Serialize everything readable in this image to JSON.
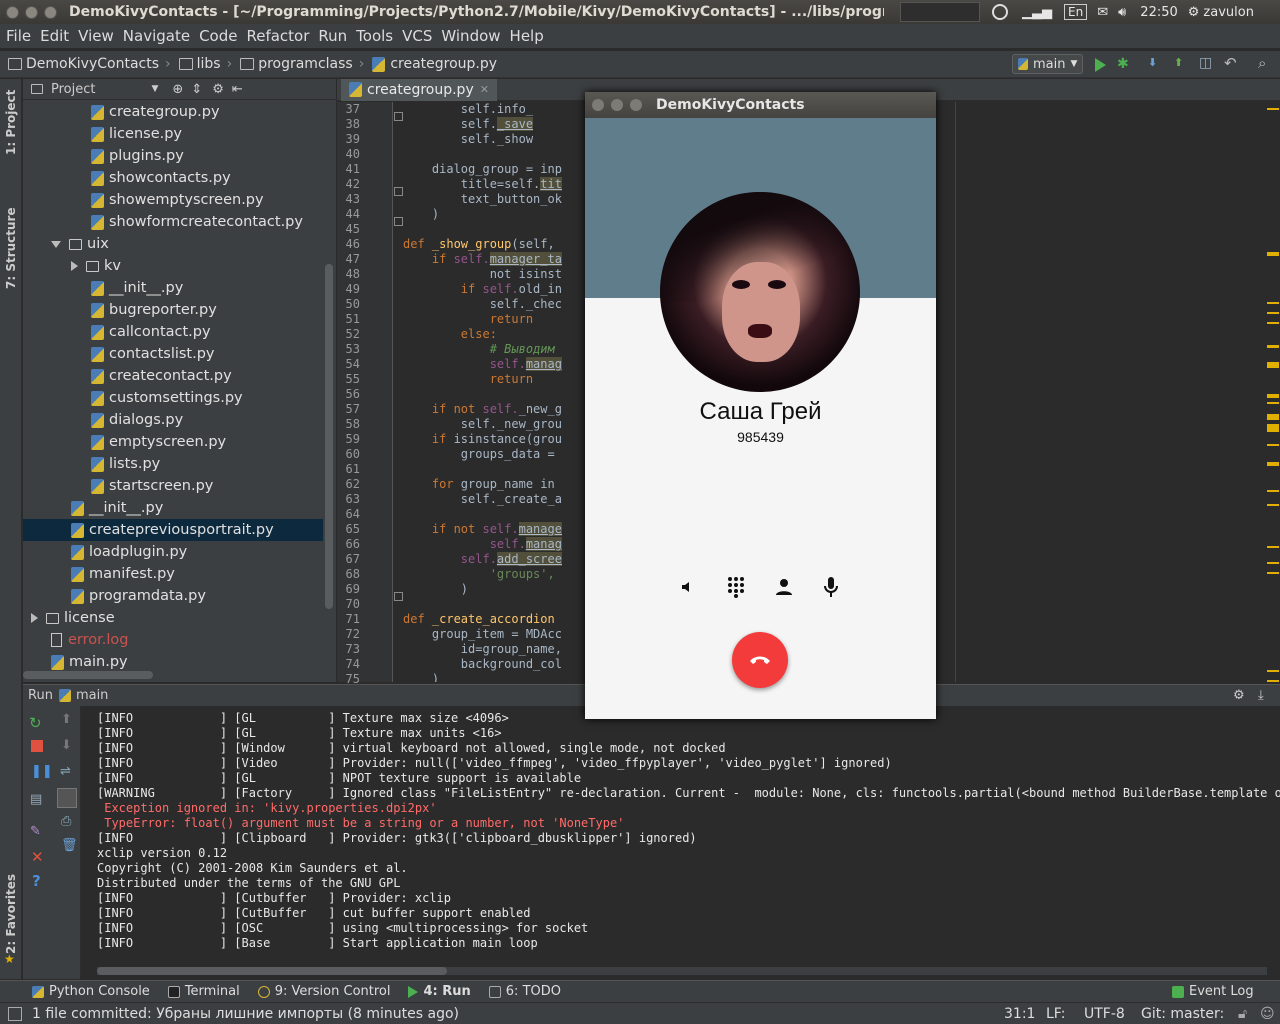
{
  "window": {
    "title": "DemoKivyContacts - [~/Programming/Projects/Python2.7/Mobile/Kivy/DemoKivyContacts] - .../libs/programclass/c",
    "tray": {
      "keyboard": "En",
      "time": "22:50",
      "user": "zavulon"
    }
  },
  "menu": [
    "File",
    "Edit",
    "View",
    "Navigate",
    "Code",
    "Refactor",
    "Run",
    "Tools",
    "VCS",
    "Window",
    "Help"
  ],
  "breadcrumb": [
    "DemoKivyContacts",
    "libs",
    "programclass",
    "creategroup.py"
  ],
  "run_config": "main",
  "left_strip": {
    "project": "1: Project",
    "structure": "7: Structure",
    "favorites": "2: Favorites"
  },
  "project_panel": {
    "title": "Project",
    "items": [
      {
        "label": "creategroup.py",
        "indent": 3,
        "type": "py"
      },
      {
        "label": "license.py",
        "indent": 3,
        "type": "py"
      },
      {
        "label": "plugins.py",
        "indent": 3,
        "type": "py"
      },
      {
        "label": "showcontacts.py",
        "indent": 3,
        "type": "py"
      },
      {
        "label": "showemptyscreen.py",
        "indent": 3,
        "type": "py"
      },
      {
        "label": "showformcreatecontact.py",
        "indent": 3,
        "type": "py"
      },
      {
        "label": "uix",
        "indent": 1,
        "type": "dir-open"
      },
      {
        "label": "kv",
        "indent": 2,
        "type": "dir-closed"
      },
      {
        "label": "__init__.py",
        "indent": 3,
        "type": "py"
      },
      {
        "label": "bugreporter.py",
        "indent": 3,
        "type": "py"
      },
      {
        "label": "callcontact.py",
        "indent": 3,
        "type": "py"
      },
      {
        "label": "contactslist.py",
        "indent": 3,
        "type": "py"
      },
      {
        "label": "createcontact.py",
        "indent": 3,
        "type": "py"
      },
      {
        "label": "customsettings.py",
        "indent": 3,
        "type": "py"
      },
      {
        "label": "dialogs.py",
        "indent": 3,
        "type": "py"
      },
      {
        "label": "emptyscreen.py",
        "indent": 3,
        "type": "py"
      },
      {
        "label": "lists.py",
        "indent": 3,
        "type": "py"
      },
      {
        "label": "startscreen.py",
        "indent": 3,
        "type": "py"
      },
      {
        "label": "__init__.py",
        "indent": 2,
        "type": "py"
      },
      {
        "label": "createpreviousportrait.py",
        "indent": 2,
        "type": "py",
        "selected": true
      },
      {
        "label": "loadplugin.py",
        "indent": 2,
        "type": "py"
      },
      {
        "label": "manifest.py",
        "indent": 2,
        "type": "py"
      },
      {
        "label": "programdata.py",
        "indent": 2,
        "type": "py"
      },
      {
        "label": "license",
        "indent": 0,
        "type": "dir-closed"
      },
      {
        "label": "error.log",
        "indent": 1,
        "type": "txt",
        "red": true
      },
      {
        "label": "main.py",
        "indent": 1,
        "type": "py"
      }
    ]
  },
  "editor": {
    "tab": "creategroup.py",
    "first_line": 37,
    "lines": [
      [
        [
          "        self.info_",
          "t"
        ]
      ],
      [
        [
          "        self.",
          "t"
        ],
        [
          "_save",
          "hl"
        ]
      ],
      [
        [
          "        self._show",
          "t"
        ]
      ],
      [
        [
          "",
          ""
        ]
      ],
      [
        [
          "    dialog_group = inp",
          "t"
        ]
      ],
      [
        [
          "        title=self.",
          "t"
        ],
        [
          "tit",
          "hl"
        ]
      ],
      [
        [
          "        text_button_ok",
          "t"
        ]
      ],
      [
        [
          "    )",
          "t"
        ]
      ],
      [
        [
          "",
          ""
        ]
      ],
      [
        [
          "def ",
          "kw"
        ],
        [
          "_show_group",
          "fn"
        ],
        [
          "(self,",
          "t"
        ]
      ],
      [
        [
          "    if ",
          "kw"
        ],
        [
          "self.",
          "self"
        ],
        [
          "manager_ta",
          "hl"
        ]
      ],
      [
        [
          "            not isinst",
          "t"
        ]
      ],
      [
        [
          "        if ",
          "kw"
        ],
        [
          "self.",
          "self"
        ],
        [
          "old_in",
          "t"
        ]
      ],
      [
        [
          "            self._chec",
          "t"
        ]
      ],
      [
        [
          "            return",
          "kw"
        ]
      ],
      [
        [
          "        else:",
          "kw"
        ]
      ],
      [
        [
          "            # Выводим",
          "cm"
        ]
      ],
      [
        [
          "            self.",
          "self"
        ],
        [
          "manag",
          "hl"
        ]
      ],
      [
        [
          "            return",
          "kw"
        ]
      ],
      [
        [
          "",
          ""
        ]
      ],
      [
        [
          "    if not ",
          "kw"
        ],
        [
          "self.",
          "self"
        ],
        [
          "_new_g",
          "t"
        ]
      ],
      [
        [
          "        self._new_grou",
          "t"
        ]
      ],
      [
        [
          "    if ",
          "kw"
        ],
        [
          "isinstance(grou",
          "t"
        ]
      ],
      [
        [
          "        groups_data = ",
          "t"
        ]
      ],
      [
        [
          "",
          ""
        ]
      ],
      [
        [
          "    for ",
          "kw"
        ],
        [
          "group_name in",
          "t"
        ]
      ],
      [
        [
          "        self._create_a",
          "t"
        ]
      ],
      [
        [
          "",
          ""
        ]
      ],
      [
        [
          "    if not ",
          "kw"
        ],
        [
          "self.",
          "self"
        ],
        [
          "manage",
          "hl"
        ]
      ],
      [
        [
          "            self.",
          "self"
        ],
        [
          "manag",
          "hl"
        ]
      ],
      [
        [
          "        self.",
          "self"
        ],
        [
          "add_scree",
          "hl"
        ]
      ],
      [
        [
          "            'groups',",
          "str"
        ]
      ],
      [
        [
          "        )",
          "t"
        ]
      ],
      [
        [
          "",
          ""
        ]
      ],
      [
        [
          "def ",
          "kw"
        ],
        [
          "_create_accordion",
          "fn"
        ]
      ],
      [
        [
          "    group_item = MDAcc",
          "t"
        ]
      ],
      [
        [
          "        id=group_name,",
          "t"
        ]
      ],
      [
        [
          "        background_col",
          "t"
        ]
      ],
      [
        [
          "    )",
          "t"
        ]
      ]
    ]
  },
  "kivy_app": {
    "title": "DemoKivyContacts",
    "contact_name": "Саша Грей",
    "contact_number": "985439",
    "header_color": "#607d8b",
    "hangup_color": "#f43b3b",
    "controls": [
      "speaker-icon",
      "dialpad-icon",
      "person-icon",
      "mic-icon"
    ]
  },
  "run_panel": {
    "label": "Run",
    "config": "main",
    "lines": [
      {
        "text": "[INFO            ] [GL          ] Texture max size <4096>",
        "err": false
      },
      {
        "text": "[INFO            ] [GL          ] Texture max units <16>",
        "err": false
      },
      {
        "text": "[INFO            ] [Window      ] virtual keyboard not allowed, single mode, not docked",
        "err": false
      },
      {
        "text": "[INFO            ] [Video       ] Provider: null(['video_ffmpeg', 'video_ffpyplayer', 'video_pyglet'] ignored)",
        "err": false
      },
      {
        "text": "[INFO            ] [GL          ] NPOT texture support is available",
        "err": false
      },
      {
        "text": "[WARNING         ] [Factory     ] Ignored class \"FileListEntry\" re-declaration. Current -  module: None, cls: functools.partial(<bound method BuilderBase.template of",
        "err": false
      },
      {
        "text": " Exception ignored in: 'kivy.properties.dpi2px'",
        "err": true
      },
      {
        "text": " TypeError: float() argument must be a string or a number, not 'NoneType'",
        "err": true
      },
      {
        "text": "[INFO            ] [Clipboard   ] Provider: gtk3(['clipboard_dbusklipper'] ignored)",
        "err": false
      },
      {
        "text": "xclip version 0.12",
        "err": false
      },
      {
        "text": "Copyright (C) 2001-2008 Kim Saunders et al.",
        "err": false
      },
      {
        "text": "Distributed under the terms of the GNU GPL",
        "err": false
      },
      {
        "text": "[INFO            ] [Cutbuffer   ] Provider: xclip",
        "err": false
      },
      {
        "text": "[INFO            ] [CutBuffer   ] cut buffer support enabled",
        "err": false
      },
      {
        "text": "[INFO            ] [OSC         ] using <multiprocessing> for socket",
        "err": false
      },
      {
        "text": "[INFO            ] [Base        ] Start application main loop",
        "err": false
      }
    ]
  },
  "tool_windows": [
    "Python Console",
    "Terminal",
    "9: Version Control",
    "4: Run",
    "6: TODO"
  ],
  "event_log": "Event Log",
  "status": {
    "message": "1 file committed: Убраны лишние импорты (8 minutes ago)",
    "position": "31:1",
    "line_sep": "LF:",
    "encoding": "UTF-8",
    "git": "Git: master:"
  },
  "colors": {
    "accent_selection": "#0d293e",
    "error_text": "#ff6b68",
    "run_green": "#4caf50"
  }
}
